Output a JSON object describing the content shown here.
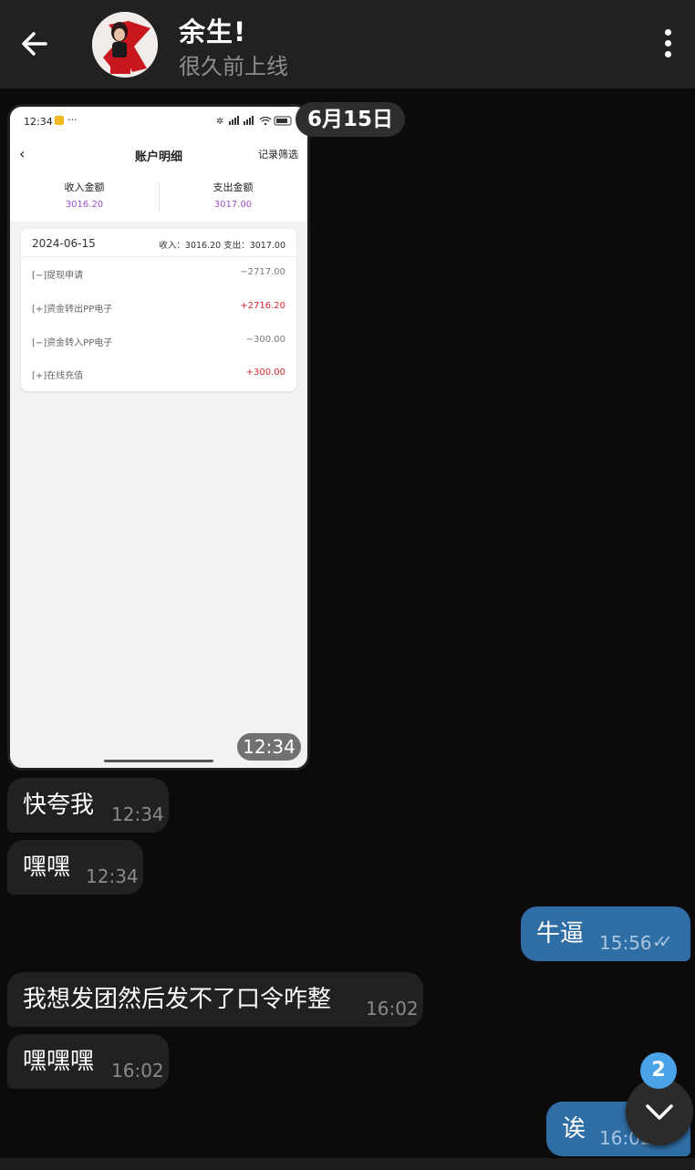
{
  "header": {
    "title": "余生!",
    "status": "很久前上线",
    "back_icon": "arrow-left-icon",
    "menu_icon": "kebab-menu-icon"
  },
  "date_chip": "6月15日",
  "photo_message": {
    "time": "12:34",
    "screenshot": {
      "status_time": "12:34",
      "status_dots": "···",
      "nav_title": "账户明细",
      "nav_filter": "记录筛选",
      "income_label": "收入金额",
      "income_value": "3016.20",
      "expense_label": "支出金额",
      "expense_value": "3017.00",
      "card_date": "2024-06-15",
      "card_summary": "收入：3016.20 支出：3017.00",
      "rows": [
        {
          "label": "[−]提现申请",
          "amount": "−2717.00",
          "positive": false
        },
        {
          "label": "[+]资金转出PP电子",
          "amount": "+2716.20",
          "positive": true
        },
        {
          "label": "[−]资金转入PP电子",
          "amount": "−300.00",
          "positive": false
        },
        {
          "label": "[+]在线充值",
          "amount": "+300.00",
          "positive": true
        }
      ]
    }
  },
  "messages": [
    {
      "text": "快夸我",
      "time": "12:34",
      "direction": "in"
    },
    {
      "text": "嘿嘿",
      "time": "12:34",
      "direction": "in"
    },
    {
      "text": "牛逼",
      "time": "15:56",
      "direction": "out",
      "status": "read"
    },
    {
      "text": "我想发团然后发不了口令咋整",
      "time": "16:02",
      "direction": "in"
    },
    {
      "text": "嘿嘿嘿",
      "time": "16:02",
      "direction": "in"
    },
    {
      "text": "诶",
      "time": "16:02",
      "direction": "out",
      "status": "read"
    }
  ],
  "scroll_badge": "2",
  "colors": {
    "background": "#0b0b0b",
    "header": "#212121",
    "incoming_bubble": "#212121",
    "outgoing_bubble": "#2f6ea5",
    "badge": "#4aa3e7"
  }
}
